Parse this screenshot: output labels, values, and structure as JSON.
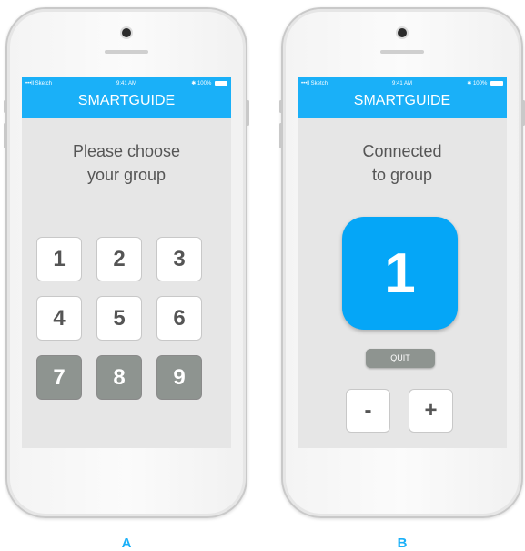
{
  "phones": [
    {
      "status": {
        "carrier": "•••ll Sketch",
        "time": "9:41 AM",
        "battery": "100%"
      },
      "app_title": "SMARTGUIDE",
      "prompt_line1": "Please choose",
      "prompt_line2": "your group",
      "groups": [
        {
          "label": "1"
        },
        {
          "label": "2"
        },
        {
          "label": "3"
        },
        {
          "label": "4"
        },
        {
          "label": "5"
        },
        {
          "label": "6"
        },
        {
          "label": "7"
        },
        {
          "label": "8"
        },
        {
          "label": "9"
        }
      ],
      "caption": "A"
    },
    {
      "status": {
        "carrier": "•••ll Sketch",
        "time": "9:41 AM",
        "battery": "100%"
      },
      "app_title": "SMARTGUIDE",
      "prompt_line1": "Connected",
      "prompt_line2": "to group",
      "group_number": "1",
      "quit_label": "QUIT",
      "minus_label": "-",
      "plus_label": "+",
      "caption": "B"
    }
  ],
  "colors": {
    "accent": "#1ab0f8",
    "tile": "#05a6f7",
    "disabled": "#8e9490",
    "screen_bg": "#e6e6e6"
  }
}
